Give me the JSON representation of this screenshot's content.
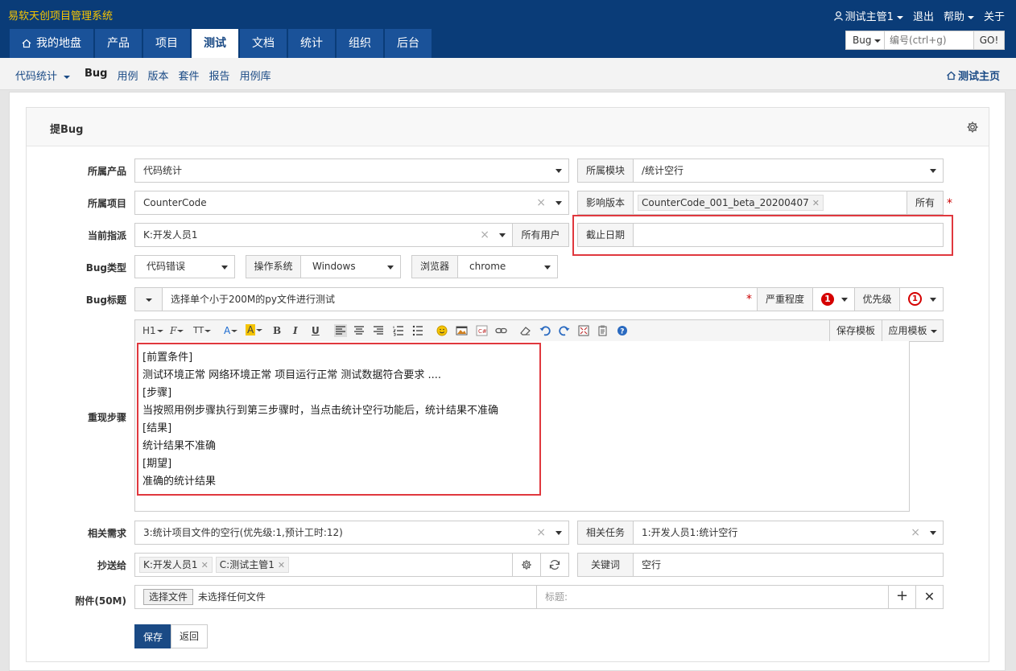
{
  "app_title": "易软天创项目管理系统",
  "top_right": {
    "user": "测试主管1",
    "logout": "退出",
    "help": "帮助",
    "about": "关于"
  },
  "nav_tabs": [
    "我的地盘",
    "产品",
    "项目",
    "测试",
    "文档",
    "统计",
    "组织",
    "后台"
  ],
  "search": {
    "type": "Bug",
    "placeholder": "编号(ctrl+g)",
    "go": "GO!"
  },
  "subnav": {
    "product": "代码统计",
    "items": [
      "Bug",
      "用例",
      "版本",
      "套件",
      "报告",
      "用例库"
    ],
    "home": "测试主页"
  },
  "panel": {
    "title": "提Bug"
  },
  "form": {
    "product": {
      "label": "所属产品",
      "value": "代码统计"
    },
    "module": {
      "label": "所属模块",
      "value": "/统计空行"
    },
    "project": {
      "label": "所属项目",
      "value": "CounterCode"
    },
    "build": {
      "label": "影响版本",
      "tag": "CounterCode_001_beta_20200407",
      "all": "所有"
    },
    "assign": {
      "label": "当前指派",
      "value": "K:开发人员1",
      "all_users": "所有用户"
    },
    "deadline": {
      "label": "截止日期",
      "value": ""
    },
    "type": {
      "label": "Bug类型",
      "value": "代码错误"
    },
    "os": {
      "label": "操作系统",
      "value": "Windows"
    },
    "browser": {
      "label": "浏览器",
      "value": "chrome"
    },
    "title": {
      "label": "Bug标题",
      "value": "选择单个小于200M的py文件进行测试"
    },
    "severity": {
      "label": "严重程度",
      "value": "1"
    },
    "priority": {
      "label": "优先级",
      "value": "1"
    },
    "steps": {
      "label": "重现步骤",
      "lines": [
        "[前置条件]",
        "测试环境正常 网络环境正常 项目运行正常 测试数据符合要求 ....",
        "[步骤]",
        "当按照用例步骤执行到第三步骤时，当点击统计空行功能后，统计结果不准确",
        "[结果]",
        "统计结果不准确",
        "[期望]",
        "准确的统计结果"
      ]
    },
    "story": {
      "label": "相关需求",
      "value": "3:统计项目文件的空行(优先级:1,预计工时:12)"
    },
    "task": {
      "label": "相关任务",
      "value": "1:开发人员1:统计空行"
    },
    "mailto": {
      "label": "抄送给",
      "tags": [
        "K:开发人员1",
        "C:测试主管1"
      ]
    },
    "keywords": {
      "label": "关键词",
      "value": "空行"
    },
    "files": {
      "label": "附件(50M)",
      "choose": "选择文件",
      "none": "未选择任何文件",
      "title_label": "标题:"
    },
    "save": "保存",
    "back": "返回"
  },
  "editor_toolbar": {
    "save_tpl": "保存模板",
    "apply_tpl": "应用模板",
    "h1": "H1",
    "font": "F",
    "size": "TT",
    "bold": "B",
    "italic": "I",
    "underline": "U"
  }
}
